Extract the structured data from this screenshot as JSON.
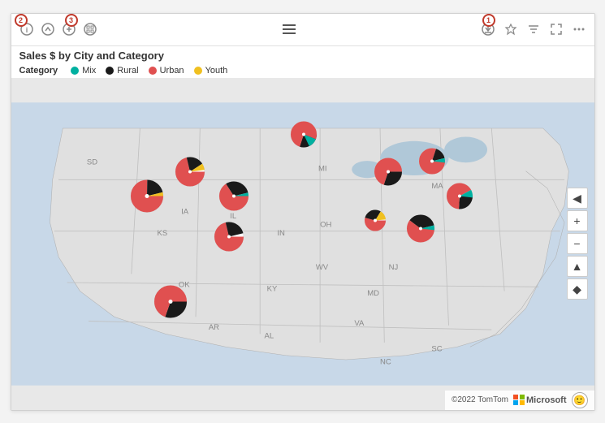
{
  "toolbar": {
    "annotation1": "1",
    "annotation2": "2",
    "annotation3": "3"
  },
  "title": "Sales $ by City and Category",
  "legend": {
    "label": "Category",
    "items": [
      {
        "name": "Mix",
        "color": "#00b0a0"
      },
      {
        "name": "Rural",
        "color": "#1a1a1a"
      },
      {
        "name": "Urban",
        "color": "#e05050"
      },
      {
        "name": "Youth",
        "color": "#f0c020"
      }
    ]
  },
  "map": {
    "attribution": "©2022 TomTom",
    "brand": "Microsoft"
  },
  "controls": {
    "zoom_in": "+",
    "zoom_out": "−",
    "back": "◄",
    "location": "◆",
    "reset_north": "▲"
  }
}
